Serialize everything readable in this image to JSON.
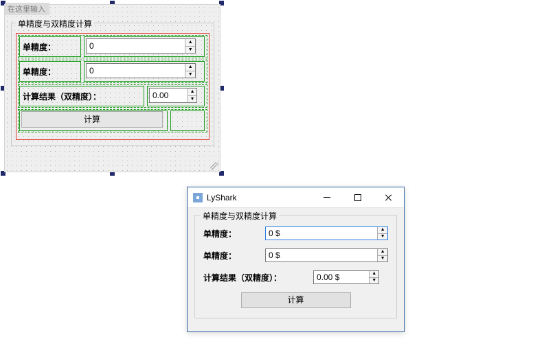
{
  "designer": {
    "placeholder_title": "在这里输入",
    "group_title": "单精度与双精度计算",
    "label_single1": "单精度：",
    "label_single2": "单精度：",
    "label_result": "计算结果（双精度）：",
    "spin1_value": "0",
    "spin2_value": "0",
    "spin3_value": "0.00",
    "calc_button": "计算"
  },
  "runtime": {
    "window_title": "LyShark",
    "group_title": "单精度与双精度计算",
    "label_single1": "单精度：",
    "label_single2": "单精度：",
    "label_result": "计算结果（双精度）：",
    "spin1_value": "0 $",
    "spin2_value": "0 $",
    "spin3_value": "0.00 $",
    "calc_button": "计算"
  }
}
